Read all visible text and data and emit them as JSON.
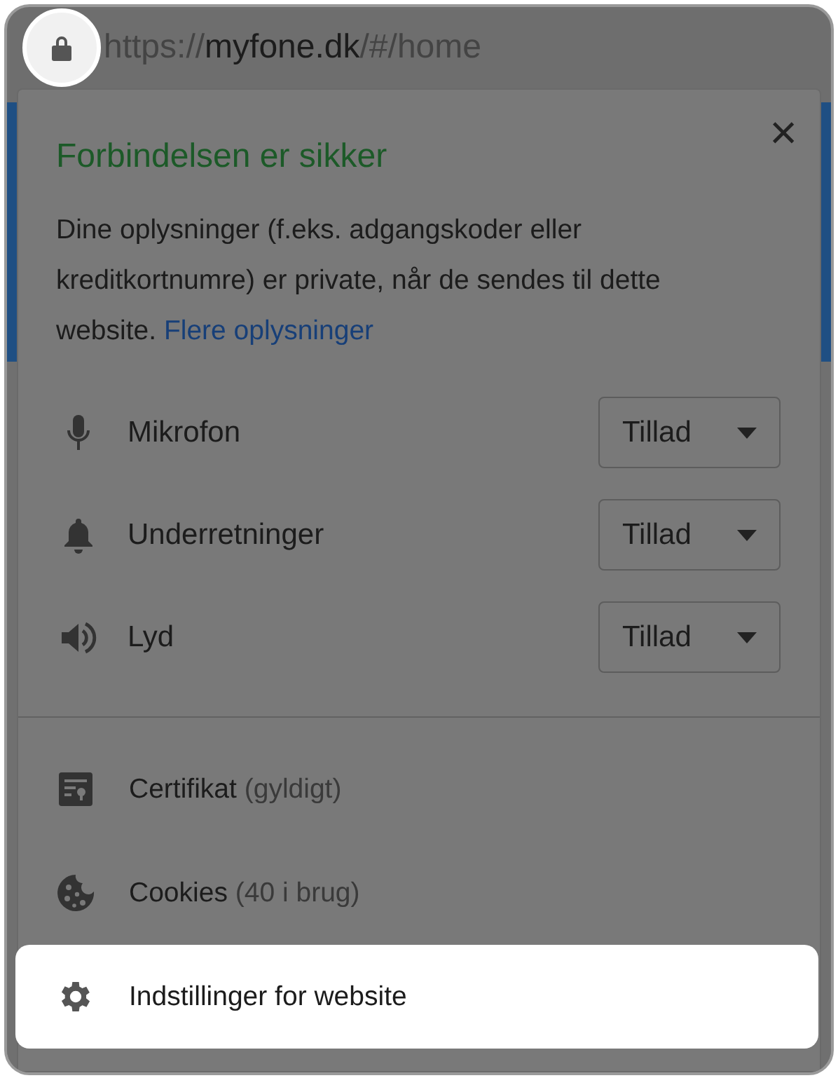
{
  "address_bar": {
    "scheme": "https://",
    "host": "myfone.dk",
    "path": "/#/home",
    "lock_highlighted": true
  },
  "popup": {
    "title": "Forbindelsen er sikker",
    "description": "Dine oplysninger (f.eks. adgangskoder eller kreditkortnumre) er private, når de sendes til dette website.",
    "link": "Flere oplysninger",
    "close": "×"
  },
  "permissions": [
    {
      "kind": "microphone",
      "label": "Mikrofon",
      "value": "Tillad"
    },
    {
      "kind": "bell",
      "label": "Underretninger",
      "value": "Tillad"
    },
    {
      "kind": "speaker",
      "label": "Lyd",
      "value": "Tillad"
    }
  ],
  "items": [
    {
      "kind": "certificate",
      "label": "Certifikat",
      "detail": "(gyldigt)",
      "highlighted": false
    },
    {
      "kind": "cookie",
      "label": "Cookies",
      "detail": "(40 i brug)",
      "highlighted": false
    },
    {
      "kind": "gear",
      "label": "Indstillinger for website",
      "highlighted": true
    }
  ]
}
